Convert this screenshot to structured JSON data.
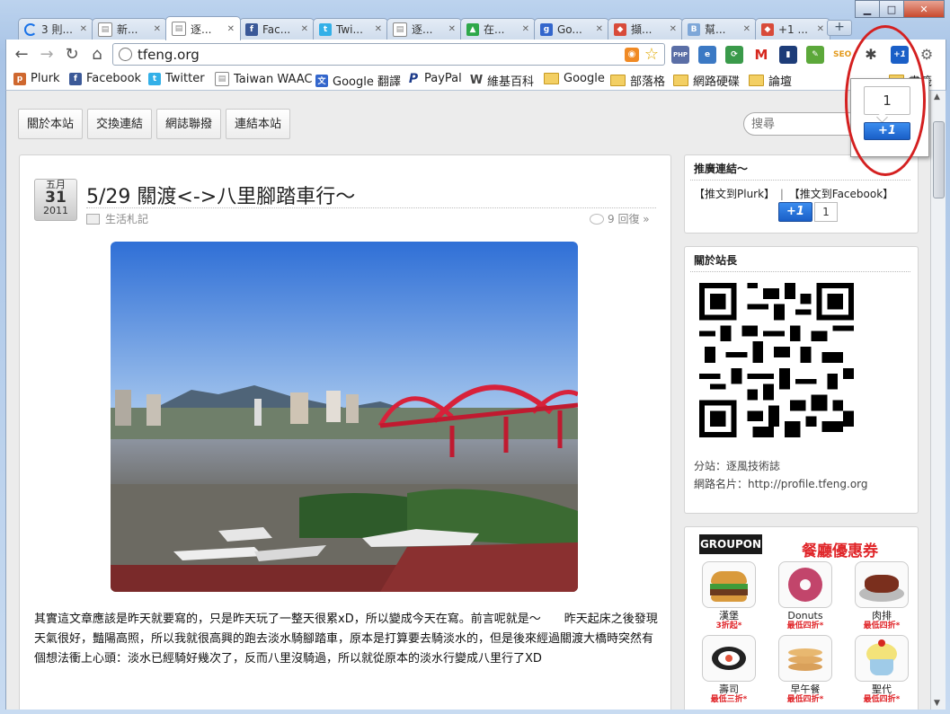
{
  "window": {
    "minimize": "▁",
    "maximize": "□",
    "close": "✕"
  },
  "tabs": [
    {
      "label": "3 則...",
      "icon": "loading-icon",
      "color": "#1a73e8"
    },
    {
      "label": "新...",
      "icon": "page-icon",
      "color": "#888888"
    },
    {
      "label": "逐...",
      "icon": "page-icon",
      "color": "#888888",
      "active": true
    },
    {
      "label": "Fac...",
      "icon": "facebook-icon",
      "color": "#3b5998"
    },
    {
      "label": "Twi...",
      "icon": "twitter-icon",
      "color": "#33b0e8"
    },
    {
      "label": "逐...",
      "icon": "page-icon",
      "color": "#888888"
    },
    {
      "label": "在...",
      "icon": "map-icon",
      "color": "#2ea84a"
    },
    {
      "label": "Go...",
      "icon": "google-icon",
      "color": "#3366cc"
    },
    {
      "label": "擷...",
      "icon": "app-icon",
      "color": "#d84b3a"
    },
    {
      "label": "幫...",
      "icon": "blogger-icon",
      "color": "#7ea7d8"
    },
    {
      "label": "+1 ...",
      "icon": "app-icon",
      "color": "#d84b3a"
    }
  ],
  "toolbar": {
    "url": "tfeng.org"
  },
  "extensions": [
    {
      "name": "php-icon",
      "text": "PHP",
      "color": "#5a6ea6"
    },
    {
      "name": "ie-icon",
      "text": "e",
      "color": "#3b79c4"
    },
    {
      "name": "sync-icon",
      "text": "⟳",
      "color": "#3a9a4a"
    },
    {
      "name": "gmail-icon",
      "text": "M",
      "color": "#d6281f"
    },
    {
      "name": "stats-icon",
      "text": "▮",
      "color": "#1d3c78"
    },
    {
      "name": "evernote-icon",
      "text": "✎",
      "color": "#5ca83a"
    },
    {
      "name": "seo-icon",
      "text": "SEO",
      "color": "#e39a1d"
    },
    {
      "name": "bug-icon",
      "text": "✱",
      "color": "#444444"
    },
    {
      "name": "plusone-icon",
      "text": "+1",
      "color": "#1a5fc7"
    }
  ],
  "bookmarks": [
    {
      "label": "Plurk",
      "icon": "plurk-icon",
      "color": "#cf682f"
    },
    {
      "label": "Facebook",
      "icon": "facebook-icon",
      "color": "#3b5998"
    },
    {
      "label": "Twitter",
      "icon": "twitter-icon",
      "color": "#33b0e8"
    },
    {
      "label": "Taiwan WAAC",
      "icon": "page-icon",
      "color": "#888888"
    },
    {
      "label": "Google 翻譯",
      "icon": "translate-icon",
      "color": "#3366cc"
    },
    {
      "label": "PayPal",
      "icon": "paypal-icon",
      "color": "#1f3d8b"
    },
    {
      "label": "維基百科",
      "icon": "wikipedia-icon",
      "color": "#444444"
    },
    {
      "label": "Google",
      "icon": "folder-icon",
      "color": "#f3cf63"
    },
    {
      "label": "部落格",
      "icon": "folder-icon",
      "color": "#f3cf63"
    },
    {
      "label": "網路硬碟",
      "icon": "folder-icon",
      "color": "#f3cf63"
    },
    {
      "label": "論壇",
      "icon": "folder-icon",
      "color": "#f3cf63"
    },
    {
      "label": "書籤",
      "icon": "folder-icon",
      "color": "#f3cf63"
    }
  ],
  "menu": [
    "關於本站",
    "交換連結",
    "網誌聯撥",
    "連結本站"
  ],
  "search": {
    "placeholder": "搜尋"
  },
  "post": {
    "month": "五月",
    "day": "31",
    "year": "2011",
    "title": "5/29 關渡<->八里腳踏車行～",
    "category": "生活札記",
    "replies": "9 回復 »",
    "body": "其實這文章應該是昨天就要寫的，只是昨天玩了一整天很累xD，所以變成今天在寫。前言呢就是～　　昨天起床之後發現天氣很好，豔陽高照，所以我就很高興的跑去淡水騎腳踏車，原本是打算要去騎淡水的，但是後來經過關渡大橋時突然有個想法衝上心頭：淡水已經騎好幾次了，反而八里沒騎過，所以就從原本的淡水行變成八里行了XD"
  },
  "sidebar": {
    "promo": {
      "title": "推廣連結～",
      "plurk": "【推文到Plurk】",
      "sep": "|",
      "facebook": "【推文到Facebook】",
      "plusone": "+1",
      "count": "1"
    },
    "about": {
      "title": "關於站長",
      "line1": "分站：逐風技術誌",
      "line2": "網路名片：http://profile.tfeng.org"
    },
    "groupon": {
      "logo": "GROUPON",
      "headline": "餐廳優惠券",
      "items": [
        {
          "name": "漢堡",
          "price": "3折起*"
        },
        {
          "name": "Donuts",
          "price": "最低四折*"
        },
        {
          "name": "肉排",
          "price": "最低四折*"
        },
        {
          "name": "壽司",
          "price": "最低三折*"
        },
        {
          "name": "早午餐",
          "price": "最低四折*"
        },
        {
          "name": "聖代",
          "price": "最低四折*"
        }
      ]
    }
  },
  "popup": {
    "count": "1",
    "button": "+1"
  },
  "colors": {
    "highlight": "#d42020",
    "plusone": "#1a5fc7",
    "groupon": "#e0262a"
  }
}
